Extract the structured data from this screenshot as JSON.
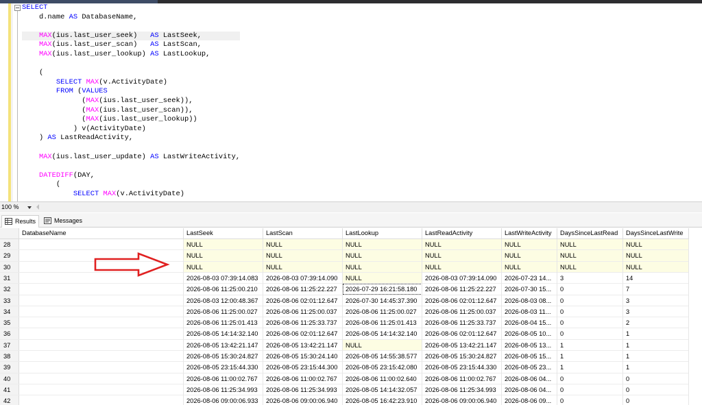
{
  "editor": {
    "code_lines": [
      {
        "parts": [
          {
            "t": "SELECT",
            "c": "kw"
          }
        ]
      },
      {
        "parts": [
          {
            "t": "    d.name "
          },
          {
            "t": "AS",
            "c": "kw"
          },
          {
            "t": " DatabaseName,"
          }
        ]
      },
      {
        "parts": [
          {
            "t": ""
          }
        ]
      },
      {
        "parts": [
          {
            "t": "    "
          },
          {
            "t": "MAX",
            "c": "fn"
          },
          {
            "t": "(ius.last_user_seek)   ",
            "c": ""
          },
          {
            "t": "AS",
            "c": "kw"
          },
          {
            "t": " LastSeek,"
          }
        ],
        "highlight": true
      },
      {
        "parts": [
          {
            "t": "    "
          },
          {
            "t": "MAX",
            "c": "fn"
          },
          {
            "t": "(ius.last_user_scan)   "
          },
          {
            "t": "AS",
            "c": "kw"
          },
          {
            "t": " LastScan,"
          }
        ]
      },
      {
        "parts": [
          {
            "t": "    "
          },
          {
            "t": "MAX",
            "c": "fn"
          },
          {
            "t": "(ius.last_user_lookup) "
          },
          {
            "t": "AS",
            "c": "kw"
          },
          {
            "t": " LastLookup,"
          }
        ]
      },
      {
        "parts": [
          {
            "t": ""
          }
        ]
      },
      {
        "parts": [
          {
            "t": "    ("
          }
        ]
      },
      {
        "parts": [
          {
            "t": "        "
          },
          {
            "t": "SELECT",
            "c": "kw"
          },
          {
            "t": " "
          },
          {
            "t": "MAX",
            "c": "fn"
          },
          {
            "t": "(v.ActivityDate)"
          }
        ]
      },
      {
        "parts": [
          {
            "t": "        "
          },
          {
            "t": "FROM",
            "c": "kw"
          },
          {
            "t": " ("
          },
          {
            "t": "VALUES",
            "c": "kw"
          }
        ]
      },
      {
        "parts": [
          {
            "t": "              ("
          },
          {
            "t": "MAX",
            "c": "fn"
          },
          {
            "t": "(ius.last_user_seek)),"
          }
        ]
      },
      {
        "parts": [
          {
            "t": "              ("
          },
          {
            "t": "MAX",
            "c": "fn"
          },
          {
            "t": "(ius.last_user_scan)),"
          }
        ]
      },
      {
        "parts": [
          {
            "t": "              ("
          },
          {
            "t": "MAX",
            "c": "fn"
          },
          {
            "t": "(ius.last_user_lookup))"
          }
        ]
      },
      {
        "parts": [
          {
            "t": "            ) v(ActivityDate)"
          }
        ]
      },
      {
        "parts": [
          {
            "t": "    ) "
          },
          {
            "t": "AS",
            "c": "kw"
          },
          {
            "t": " LastReadActivity,"
          }
        ]
      },
      {
        "parts": [
          {
            "t": ""
          }
        ]
      },
      {
        "parts": [
          {
            "t": "    "
          },
          {
            "t": "MAX",
            "c": "fn"
          },
          {
            "t": "(ius.last_user_update) "
          },
          {
            "t": "AS",
            "c": "kw"
          },
          {
            "t": " LastWriteActivity,"
          }
        ]
      },
      {
        "parts": [
          {
            "t": ""
          }
        ]
      },
      {
        "parts": [
          {
            "t": "    "
          },
          {
            "t": "DATEDIFF",
            "c": "fn"
          },
          {
            "t": "(DAY,"
          }
        ]
      },
      {
        "parts": [
          {
            "t": "        ("
          }
        ]
      },
      {
        "parts": [
          {
            "t": "            "
          },
          {
            "t": "SELECT",
            "c": "kw"
          },
          {
            "t": " "
          },
          {
            "t": "MAX",
            "c": "fn"
          },
          {
            "t": "(v.ActivityDate)"
          }
        ]
      }
    ]
  },
  "zoom": {
    "value": "100 %"
  },
  "tabs": [
    {
      "label": "Results"
    },
    {
      "label": "Messages"
    }
  ],
  "grid": {
    "columns": [
      "DatabaseName",
      "LastSeek",
      "LastScan",
      "LastLookup",
      "LastReadActivity",
      "LastWriteActivity",
      "DaysSinceLastRead",
      "DaysSinceLastWrite"
    ],
    "rows": [
      {
        "num": "28",
        "cells": [
          "",
          "NULL",
          "NULL",
          "NULL",
          "NULL",
          "NULL",
          "NULL",
          "NULL"
        ]
      },
      {
        "num": "29",
        "cells": [
          "",
          "NULL",
          "NULL",
          "NULL",
          "NULL",
          "NULL",
          "NULL",
          "NULL"
        ]
      },
      {
        "num": "30",
        "cells": [
          "",
          "NULL",
          "NULL",
          "NULL",
          "NULL",
          "NULL",
          "NULL",
          "NULL"
        ]
      },
      {
        "num": "31",
        "cells": [
          "",
          "2026-08-03 07:39:14.083",
          "2026-08-03 07:39:14.090",
          "NULL",
          "2026-08-03 07:39:14.090",
          "2026-07-23 14...",
          "3",
          "14"
        ]
      },
      {
        "num": "32",
        "cells": [
          "",
          "2026-08-06 11:25:00.210",
          "2026-08-06 11:25:22.227",
          "2026-07-29 16:21:58.180",
          "2026-08-06 11:25:22.227",
          "2026-07-30 15...",
          "0",
          "7"
        ]
      },
      {
        "num": "33",
        "cells": [
          "",
          "2026-08-03 12:00:48.367",
          "2026-08-06 02:01:12.647",
          "2026-07-30 14:45:37.390",
          "2026-08-06 02:01:12.647",
          "2026-08-03 08...",
          "0",
          "3"
        ]
      },
      {
        "num": "34",
        "cells": [
          "",
          "2026-08-06 11:25:00.027",
          "2026-08-06 11:25:00.037",
          "2026-08-06 11:25:00.027",
          "2026-08-06 11:25:00.037",
          "2026-08-03 11...",
          "0",
          "3"
        ]
      },
      {
        "num": "35",
        "cells": [
          "",
          "2026-08-06 11:25:01.413",
          "2026-08-06 11:25:33.737",
          "2026-08-06 11:25:01.413",
          "2026-08-06 11:25:33.737",
          "2026-08-04 15...",
          "0",
          "2"
        ]
      },
      {
        "num": "36",
        "cells": [
          "",
          "2026-08-05 14:14:32.140",
          "2026-08-06 02:01:12.647",
          "2026-08-05 14:14:32.140",
          "2026-08-06 02:01:12.647",
          "2026-08-05 10...",
          "0",
          "1"
        ]
      },
      {
        "num": "37",
        "cells": [
          "",
          "2026-08-05 13:42:21.147",
          "2026-08-05 13:42:21.147",
          "NULL",
          "2026-08-05 13:42:21.147",
          "2026-08-05 13...",
          "1",
          "1"
        ]
      },
      {
        "num": "38",
        "cells": [
          "",
          "2026-08-05 15:30:24.827",
          "2026-08-05 15:30:24.140",
          "2026-08-05 14:55:38.577",
          "2026-08-05 15:30:24.827",
          "2026-08-05 15...",
          "1",
          "1"
        ]
      },
      {
        "num": "39",
        "cells": [
          "",
          "2026-08-05 23:15:44.330",
          "2026-08-05 23:15:44.300",
          "2026-08-05 23:15:42.080",
          "2026-08-05 23:15:44.330",
          "2026-08-05 23...",
          "1",
          "1"
        ]
      },
      {
        "num": "40",
        "cells": [
          "",
          "2026-08-06 11:00:02.767",
          "2026-08-06 11:00:02.767",
          "2026-08-06 11:00:02.640",
          "2026-08-06 11:00:02.767",
          "2026-08-06 04...",
          "0",
          "0"
        ]
      },
      {
        "num": "41",
        "cells": [
          "",
          "2026-08-06 11:25:34.993",
          "2026-08-06 11:25:34.993",
          "2026-08-05 14:14:32.057",
          "2026-08-06 11:25:34.993",
          "2026-08-06 04...",
          "0",
          "0"
        ]
      },
      {
        "num": "42",
        "cells": [
          "",
          "2026-08-06 09:00:06.933",
          "2026-08-06 09:00:06.940",
          "2026-08-05 16:42:23.910",
          "2026-08-06 09:00:06.940",
          "2026-08-06 09...",
          "0",
          "0"
        ]
      }
    ],
    "selected_cell": {
      "row": "32",
      "column": "LastLookup"
    }
  },
  "annotation": {
    "arrow_color": "#e02020"
  },
  "colors": {
    "keyword": "#0000ff",
    "function": "#ff00ff",
    "null_cell_bg": "#fdfde3"
  }
}
